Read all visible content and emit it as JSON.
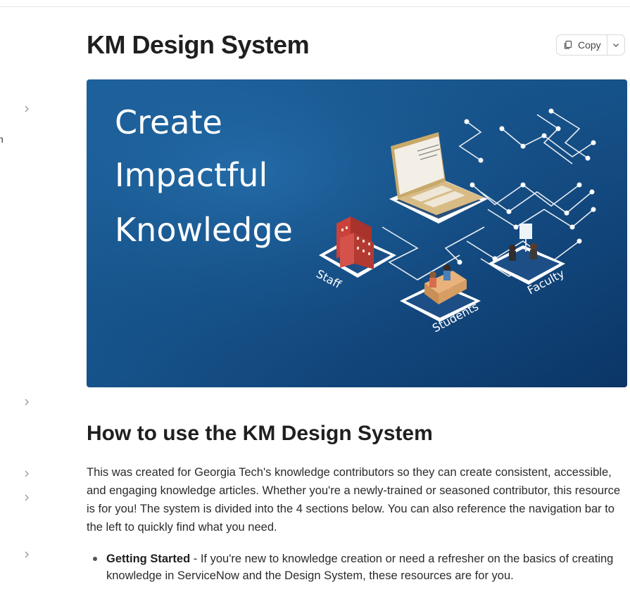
{
  "page": {
    "title": "KM Design System",
    "copy_label": "Copy"
  },
  "sidebar": {
    "fragment": "n"
  },
  "hero": {
    "line1": "Create",
    "line2": "Impactful",
    "line3": "Knowledge",
    "label_staff": "Staff",
    "label_students": "Students",
    "label_faculty": "Faculty"
  },
  "section": {
    "heading": "How to use the KM Design System",
    "intro": "This was created for Georgia Tech's knowledge contributors so they can create consistent, accessible, and engaging knowledge articles. Whether you're a newly-trained or seasoned contributor, this resource is for you! The system is divided into the 4 sections below. You can also reference the navigation bar to the left to quickly find what you need.",
    "bullets": [
      {
        "term": "Getting Started",
        "text": " - If you're new to knowledge creation or need a refresher on the basics of creating knowledge in ServiceNow and the Design System, these resources are for you."
      }
    ]
  },
  "colors": {
    "hero_bg_light": "#1a5e98",
    "hero_bg_dark": "#0a2f5c",
    "accent_red": "#c9413a"
  }
}
